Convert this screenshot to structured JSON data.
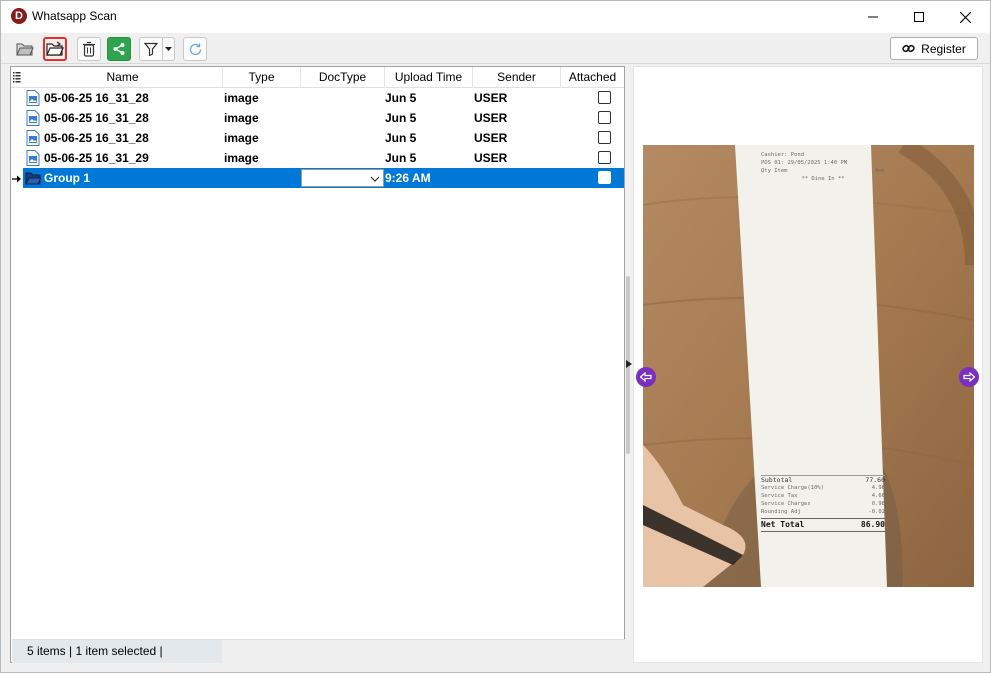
{
  "window": {
    "title": "Whatsapp Scan",
    "app_icon_letter": "D"
  },
  "toolbar": {
    "register_label": "Register",
    "buttons": [
      "open-icon",
      "open-folder-icon",
      "trash-icon",
      "share-icon",
      "filter-icon",
      "refresh-icon"
    ]
  },
  "table": {
    "columns": [
      "Name",
      "Type",
      "DocType",
      "Upload Time",
      "Sender",
      "Attached"
    ],
    "rows": [
      {
        "name": "05-06-25 16_31_28",
        "type": "image",
        "doctype": "",
        "upload_time": "Jun 5",
        "sender": "USER",
        "attached": false
      },
      {
        "name": "05-06-25 16_31_28",
        "type": "image",
        "doctype": "",
        "upload_time": "Jun 5",
        "sender": "USER",
        "attached": false
      },
      {
        "name": "05-06-25 16_31_28",
        "type": "image",
        "doctype": "",
        "upload_time": "Jun 5",
        "sender": "USER",
        "attached": false
      },
      {
        "name": "05-06-25 16_31_29",
        "type": "image",
        "doctype": "",
        "upload_time": "Jun 5",
        "sender": "USER",
        "attached": false
      },
      {
        "name": "Group 1",
        "type": "",
        "doctype": "",
        "upload_time": "9:26 AM",
        "sender": "",
        "attached": false,
        "selected": true
      }
    ]
  },
  "status": {
    "text": "5 items |  1 item selected |"
  },
  "preview": {
    "receipt": {
      "header_line1": "Cashier: Pond",
      "header_line2": "POS 01: 29/05/2025 1:40 PM",
      "qty_label": "Qty Item",
      "amount_label": "Amt",
      "dine_in": "** Dine In **",
      "subtotal_label": "Subtotal",
      "subtotal_value": "77.60",
      "service_label": "Service Charge(10%)",
      "service_value": "4.98",
      "service_tax_label": "Service Tax",
      "service_tax_value": "4.66",
      "service_charges_label": "Service Charges",
      "service_charges_value": "0.98",
      "rounding_label": "Rounding Adj",
      "rounding_value": "-0.02",
      "net_total_label": "Net Total",
      "net_total_value": "86.90"
    }
  },
  "colors": {
    "selection": "#0078d7",
    "accent": "#7a2fc0",
    "highlight_border": "#e0312f",
    "share_green": "#2ea44f"
  }
}
